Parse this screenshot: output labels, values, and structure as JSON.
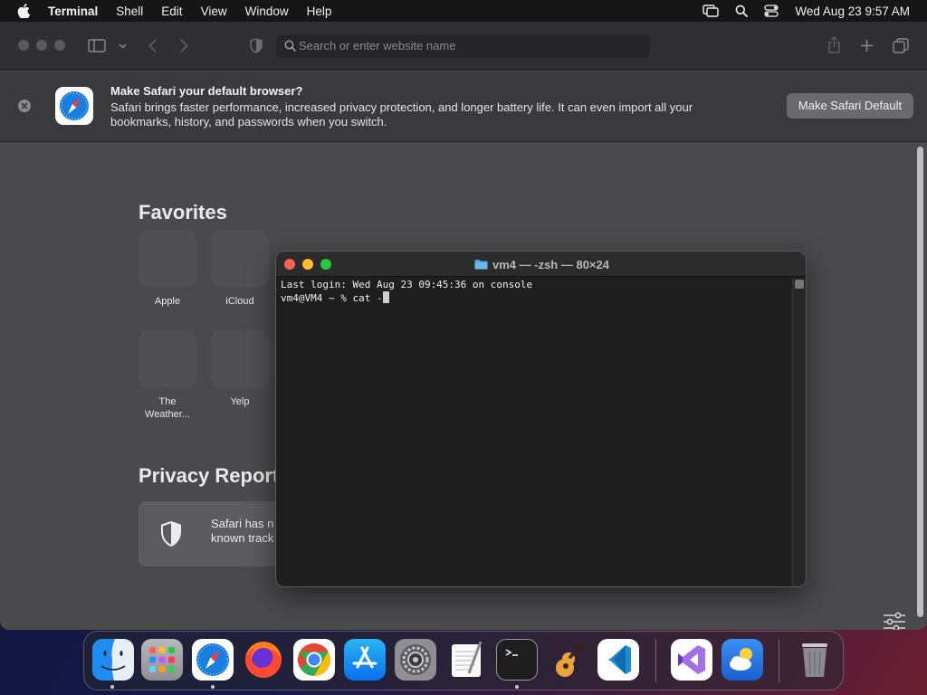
{
  "menubar": {
    "app_name": "Terminal",
    "menus": [
      "Shell",
      "Edit",
      "View",
      "Window",
      "Help"
    ],
    "clock": "Wed Aug 23  9:57 AM",
    "status_icons": [
      "screen-mirroring-icon",
      "spotlight-search-icon",
      "control-center-icon"
    ]
  },
  "safari": {
    "search": {
      "placeholder": "Search or enter website name"
    },
    "banner": {
      "title": "Make Safari your default browser?",
      "text": "Safari brings faster performance, increased privacy protection, and longer battery life. It can even import all your bookmarks, history, and passwords when you switch.",
      "button": "Make Safari Default"
    },
    "favorites": {
      "title": "Favorites",
      "items": [
        {
          "label": "Apple"
        },
        {
          "label": "iCloud"
        },
        {
          "label": "The\nWeather..."
        },
        {
          "label": "Yelp"
        }
      ]
    },
    "privacy": {
      "title": "Privacy Report",
      "text_partial": "Safari has n\nknown track"
    }
  },
  "terminal": {
    "title": "vm4 — -zsh — 80×24",
    "lines": [
      "Last login: Wed Aug 23 09:45:36 on console",
      "vm4@VM4 ~ % cat -"
    ]
  },
  "dock": {
    "apps": [
      "Finder",
      "Launchpad",
      "Safari",
      "Firefox",
      "Google Chrome",
      "App Store",
      "System Settings",
      "TextEdit",
      "Terminal",
      "GarageBand",
      "Visual Studio Code",
      "Visual Studio",
      "Weather",
      "Trash"
    ],
    "running": [
      "Finder",
      "Safari",
      "Terminal"
    ]
  },
  "colors": {
    "accent_blue": "#1a7ee0",
    "traffic_red": "#fe5f57",
    "traffic_yellow": "#febc2e",
    "traffic_green": "#28c840"
  }
}
